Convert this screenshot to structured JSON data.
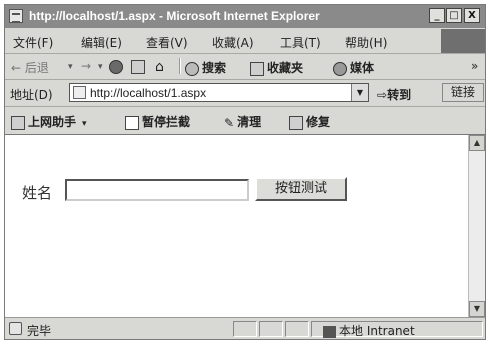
{
  "window": {
    "title": "http://localhost/1.aspx - Microsoft Internet Explorer",
    "controls": [
      "_",
      "□",
      "X"
    ]
  },
  "menu": [
    "文件(F)",
    "编辑(E)",
    "查看(V)",
    "收藏(A)",
    "工具(T)",
    "帮助(H)"
  ],
  "toolbar": {
    "back": "← 后退",
    "forward": "→",
    "search": "搜索",
    "favorites": "收藏夹",
    "media": "媒体",
    "more": "»"
  },
  "address": {
    "label": "地址(D)",
    "url": "http://localhost/1.aspx",
    "go": "转到",
    "links": "链接"
  },
  "linkbar": {
    "assistant": "上网助手",
    "popup_block": "暂停拦截",
    "clean": "清理",
    "repair": "修复"
  },
  "page": {
    "name_label": "姓名",
    "name_value": "",
    "button_label": "按钮测试"
  },
  "status": {
    "text": "完毕",
    "zone": "本地 Intranet"
  }
}
